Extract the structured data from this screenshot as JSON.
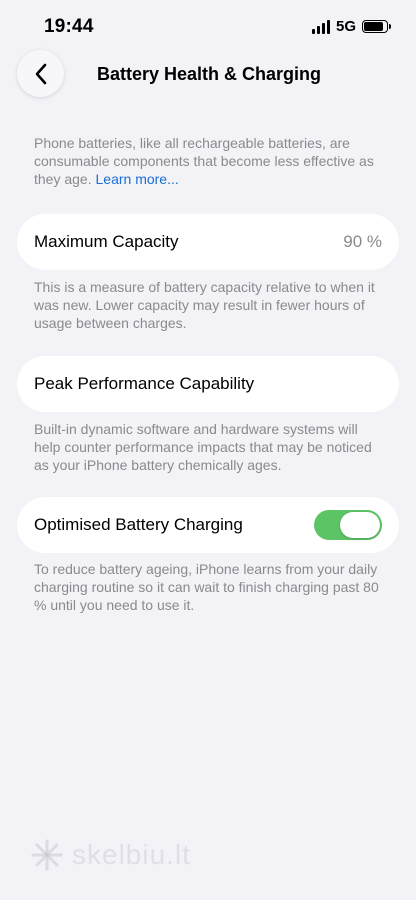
{
  "status_bar": {
    "time": "19:44",
    "network": "5G",
    "signal_icon": "signal-bars-icon",
    "battery_icon": "battery-icon"
  },
  "nav": {
    "back_icon": "chevron-left-icon",
    "title": "Battery Health & Charging"
  },
  "intro": {
    "text": "Phone batteries, like all rechargeable batteries, are consumable components that become less effective as they age. ",
    "link": "Learn more..."
  },
  "maximum_capacity": {
    "label": "Maximum Capacity",
    "value": "90 %",
    "footnote": "This is a measure of battery capacity relative to when it was new. Lower capacity may result in fewer hours of usage between charges."
  },
  "peak_performance": {
    "label": "Peak Performance Capability",
    "footnote": "Built-in dynamic software and hardware systems will help counter performance impacts that may be noticed as your iPhone battery chemically ages."
  },
  "optimised_charging": {
    "label": "Optimised Battery Charging",
    "enabled": true,
    "footnote": "To reduce battery ageing, iPhone learns from your daily charging routine so it can wait to finish charging past 80 % until you need to use it."
  },
  "watermark": {
    "text": "skelbiu.lt"
  },
  "colors": {
    "background": "#f2f2f7",
    "toggle_on": "#5dc466",
    "link": "#1a6fd6",
    "secondary_text": "#8a8a8e"
  }
}
